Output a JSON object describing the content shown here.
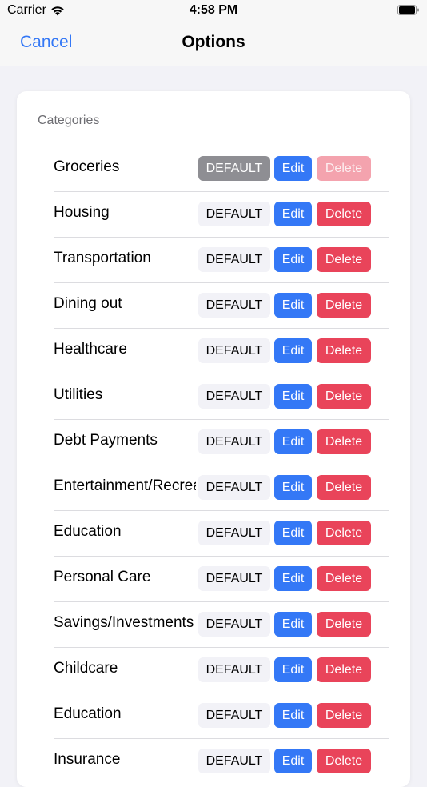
{
  "status_bar": {
    "carrier": "Carrier",
    "time": "4:58 PM"
  },
  "nav": {
    "cancel_label": "Cancel",
    "title": "Options"
  },
  "section": {
    "title": "Categories"
  },
  "buttons": {
    "default_label": "DEFAULT",
    "edit_label": "Edit",
    "delete_label": "Delete"
  },
  "categories": [
    {
      "name": "Groceries",
      "is_default": true
    },
    {
      "name": "Housing"
    },
    {
      "name": "Transportation"
    },
    {
      "name": "Dining out"
    },
    {
      "name": "Healthcare"
    },
    {
      "name": "Utilities"
    },
    {
      "name": "Debt Payments"
    },
    {
      "name": "Entertainment/Recreation"
    },
    {
      "name": "Education"
    },
    {
      "name": "Personal Care"
    },
    {
      "name": "Savings/Investments"
    },
    {
      "name": "Childcare"
    },
    {
      "name": "Education"
    },
    {
      "name": "Insurance"
    }
  ],
  "colors": {
    "accent": "#3478f6",
    "danger": "#e9445a",
    "default_active": "#8e8e93"
  }
}
